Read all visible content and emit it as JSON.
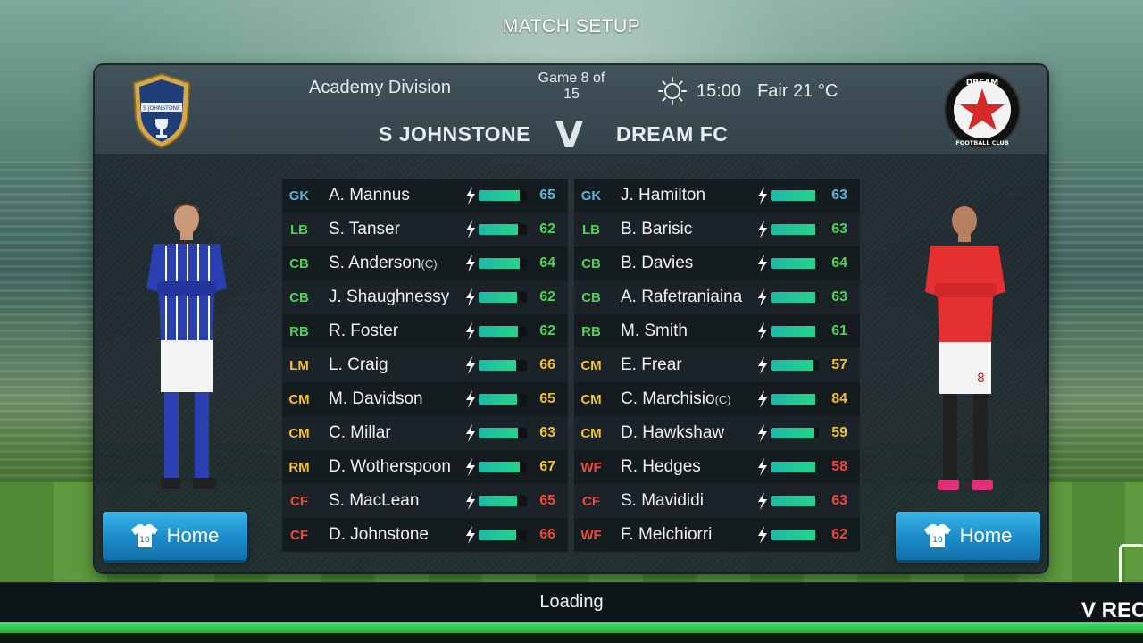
{
  "screen_title": "MATCH SETUP",
  "match": {
    "division": "Academy Division",
    "game_number": "Game 8 of 15",
    "time": "15:00",
    "weather": "Fair 21 °C",
    "vs": "V"
  },
  "home": {
    "team": "S JOHNSTONE",
    "kit_label": "Home",
    "kit_number": "10",
    "crest_text": "S JOHNSTONE",
    "players": [
      {
        "pos": "GK",
        "name": "A. Mannus",
        "captain": "",
        "rating": "65",
        "energy": 0.85
      },
      {
        "pos": "LB",
        "name": "S. Tanser",
        "captain": "",
        "rating": "62",
        "energy": 0.82
      },
      {
        "pos": "CB",
        "name": "S. Anderson",
        "captain": "(C)",
        "rating": "64",
        "energy": 0.86
      },
      {
        "pos": "CB",
        "name": "J. Shaughnessy",
        "captain": "",
        "rating": "62",
        "energy": 0.8
      },
      {
        "pos": "RB",
        "name": "R. Foster",
        "captain": "",
        "rating": "62",
        "energy": 0.82
      },
      {
        "pos": "LM",
        "name": "L. Craig",
        "captain": "",
        "rating": "66",
        "energy": 0.78
      },
      {
        "pos": "CM",
        "name": "M. Davidson",
        "captain": "",
        "rating": "65",
        "energy": 0.8
      },
      {
        "pos": "CM",
        "name": "C. Millar",
        "captain": "",
        "rating": "63",
        "energy": 0.82
      },
      {
        "pos": "RM",
        "name": "D. Wotherspoon",
        "captain": "",
        "rating": "67",
        "energy": 0.86
      },
      {
        "pos": "CF",
        "name": "S. MacLean",
        "captain": "",
        "rating": "65",
        "energy": 0.8
      },
      {
        "pos": "CF",
        "name": "D. Johnstone",
        "captain": "",
        "rating": "66",
        "energy": 0.78
      }
    ]
  },
  "away": {
    "team": "DREAM FC",
    "kit_label": "Home",
    "kit_number": "10",
    "crest_text_top": "DREAM",
    "crest_text_bottom": "FOOTBALL CLUB",
    "players": [
      {
        "pos": "GK",
        "name": "J. Hamilton",
        "captain": "",
        "rating": "63",
        "energy": 0.92
      },
      {
        "pos": "LB",
        "name": "B. Barisic",
        "captain": "",
        "rating": "63",
        "energy": 0.92
      },
      {
        "pos": "CB",
        "name": "B. Davies",
        "captain": "",
        "rating": "64",
        "energy": 0.92
      },
      {
        "pos": "CB",
        "name": "A. Rafetraniaina",
        "captain": "",
        "rating": "63",
        "energy": 0.92
      },
      {
        "pos": "RB",
        "name": "M. Smith",
        "captain": "",
        "rating": "61",
        "energy": 0.92
      },
      {
        "pos": "CM",
        "name": "E. Frear",
        "captain": "",
        "rating": "57",
        "energy": 0.88
      },
      {
        "pos": "CM",
        "name": "C. Marchisio",
        "captain": "(C)",
        "rating": "84",
        "energy": 0.92
      },
      {
        "pos": "CM",
        "name": "D. Hawkshaw",
        "captain": "",
        "rating": "59",
        "energy": 0.9
      },
      {
        "pos": "WF",
        "name": "R. Hedges",
        "captain": "",
        "rating": "58",
        "energy": 0.92
      },
      {
        "pos": "CF",
        "name": "S. Mavididi",
        "captain": "",
        "rating": "63",
        "energy": 0.92
      },
      {
        "pos": "WF",
        "name": "F. Melchiorri",
        "captain": "",
        "rating": "62",
        "energy": 0.92
      }
    ]
  },
  "pos_colors": {
    "GK": "#5fb3d6",
    "LB": "#4fd15a",
    "CB": "#4fd15a",
    "RB": "#4fd15a",
    "LM": "#f2c230",
    "CM": "#f2c230",
    "RM": "#f2c230",
    "CF": "#f0483a",
    "WF": "#f0483a"
  },
  "footer": {
    "status": "Loading",
    "watermark": "V REC"
  }
}
